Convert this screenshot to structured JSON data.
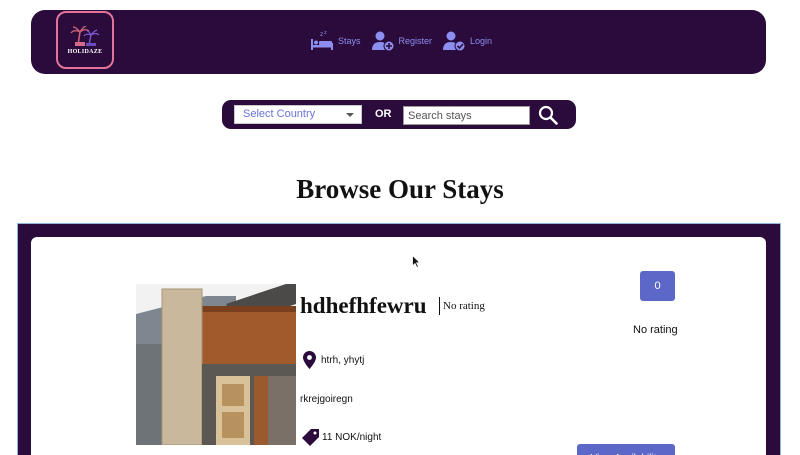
{
  "brand": {
    "name": "HOLIDAZE"
  },
  "nav": [
    {
      "label": "Stays",
      "icon": "bed-icon"
    },
    {
      "label": "Register",
      "icon": "user-plus-icon"
    },
    {
      "label": "Login",
      "icon": "user-check-icon"
    }
  ],
  "search": {
    "country_selected": "Select Country",
    "or_label": "OR",
    "placeholder": "Search stays",
    "icon": "search-icon"
  },
  "page": {
    "title": "Browse Our Stays"
  },
  "listing": {
    "name": "hdhefhfewru",
    "inline_rating": "No rating",
    "badge_value": "0",
    "side_rating": "No rating",
    "location": "htrh, yhytj",
    "description": "rkrejgoiregn",
    "price": "11 NOK/night",
    "button_label": "View Availability"
  },
  "colors": {
    "header_bg": "#2a0b3b",
    "nav_text": "#8d8ff0",
    "logo_border": "#e4739a",
    "accent": "#5b68c8"
  }
}
